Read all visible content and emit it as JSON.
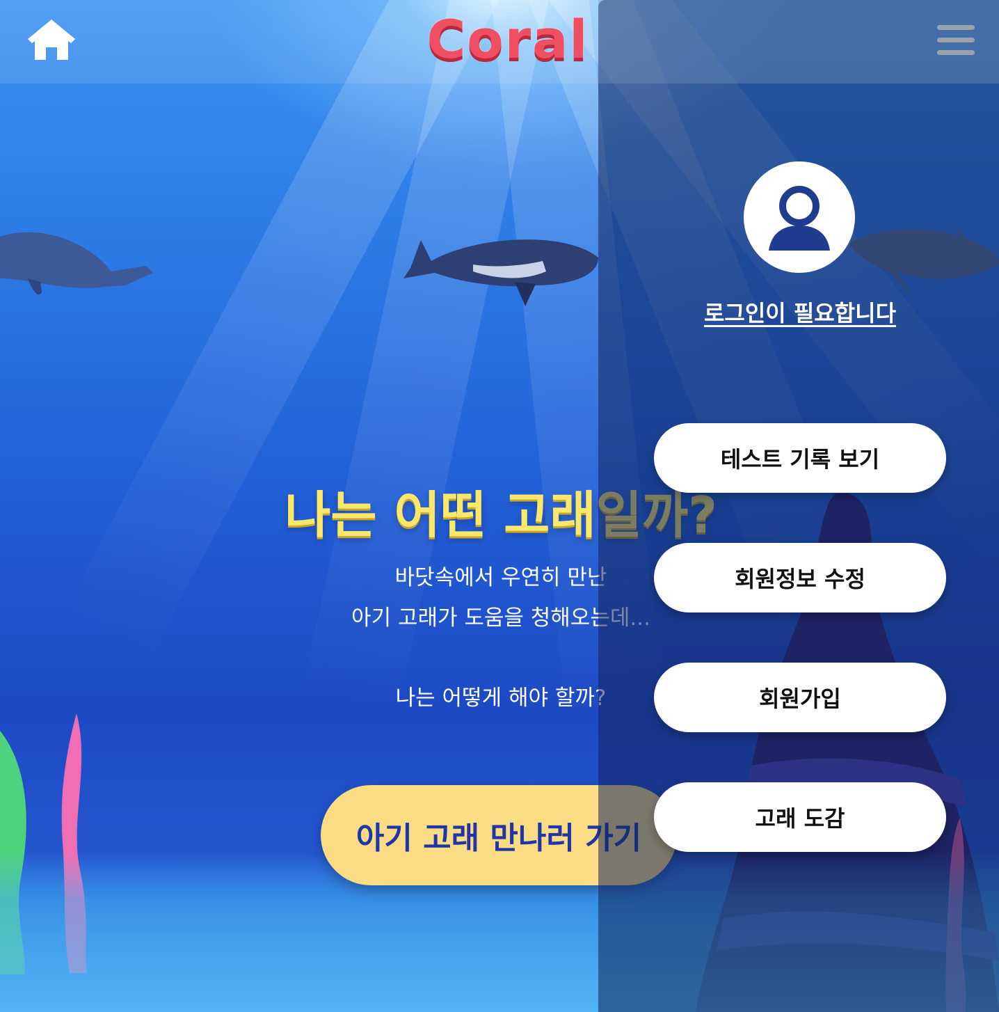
{
  "header": {
    "logo_text": "Coral",
    "home_icon": "home-icon",
    "menu_icon": "hamburger-menu-icon"
  },
  "hero": {
    "title": "나는 어떤 고래일까?",
    "lines": [
      "바닷속에서 우연히 만난",
      "아기 고래가 도움을 청해오는데...",
      "나는 어떻게 해야 할까?"
    ],
    "cta_label": "아기 고래 만나러 가기"
  },
  "drawer": {
    "avatar_icon": "user-avatar-icon",
    "login_text": "로그인이 필요합니다",
    "items": [
      {
        "label": "테스트 기록 보기"
      },
      {
        "label": "회원정보 수정"
      },
      {
        "label": "회원가입"
      },
      {
        "label": "고래 도감"
      }
    ]
  },
  "colors": {
    "logo": "#ef4f62",
    "title": "#fbe86b",
    "cta_bg": "#fbdc84",
    "cta_text": "#1f36a6",
    "ocean": "#2160d8"
  }
}
